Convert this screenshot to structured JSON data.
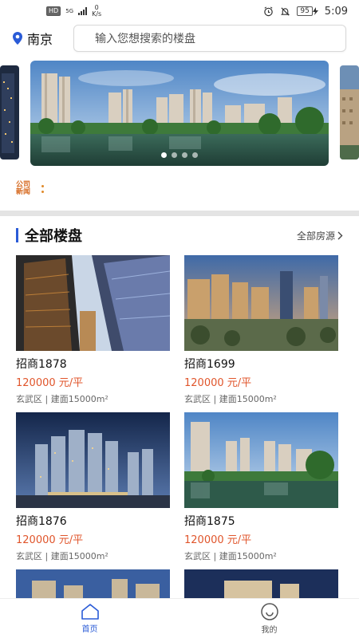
{
  "status_bar": {
    "hd": "HD",
    "network": "5G",
    "speed_value": "0",
    "speed_unit": "K/s",
    "battery": "95",
    "time": "5:09"
  },
  "header": {
    "city": "南京",
    "search_placeholder": "输入您想搜索的楼盘"
  },
  "carousel": {
    "slide_count": 4,
    "active_index": 0
  },
  "news": {
    "logo_text_1": "公司",
    "logo_text_2": "新闻"
  },
  "section": {
    "title": "全部楼盘",
    "more_label": "全部房源"
  },
  "listings": [
    {
      "name": "招商1878",
      "price": "120000 元/平",
      "meta": "玄武区 | 建面15000m²"
    },
    {
      "name": "招商1699",
      "price": "120000 元/平",
      "meta": "玄武区 | 建面15000m²"
    },
    {
      "name": "招商1876",
      "price": "120000 元/平",
      "meta": "玄武区 | 建面15000m²"
    },
    {
      "name": "招商1875",
      "price": "120000 元/平",
      "meta": "玄武区 | 建面15000m²"
    }
  ],
  "bottom_nav": {
    "home_label": "首页",
    "mine_label": "我的"
  },
  "colors": {
    "accent": "#2a5bd7",
    "price": "#e0552b"
  }
}
